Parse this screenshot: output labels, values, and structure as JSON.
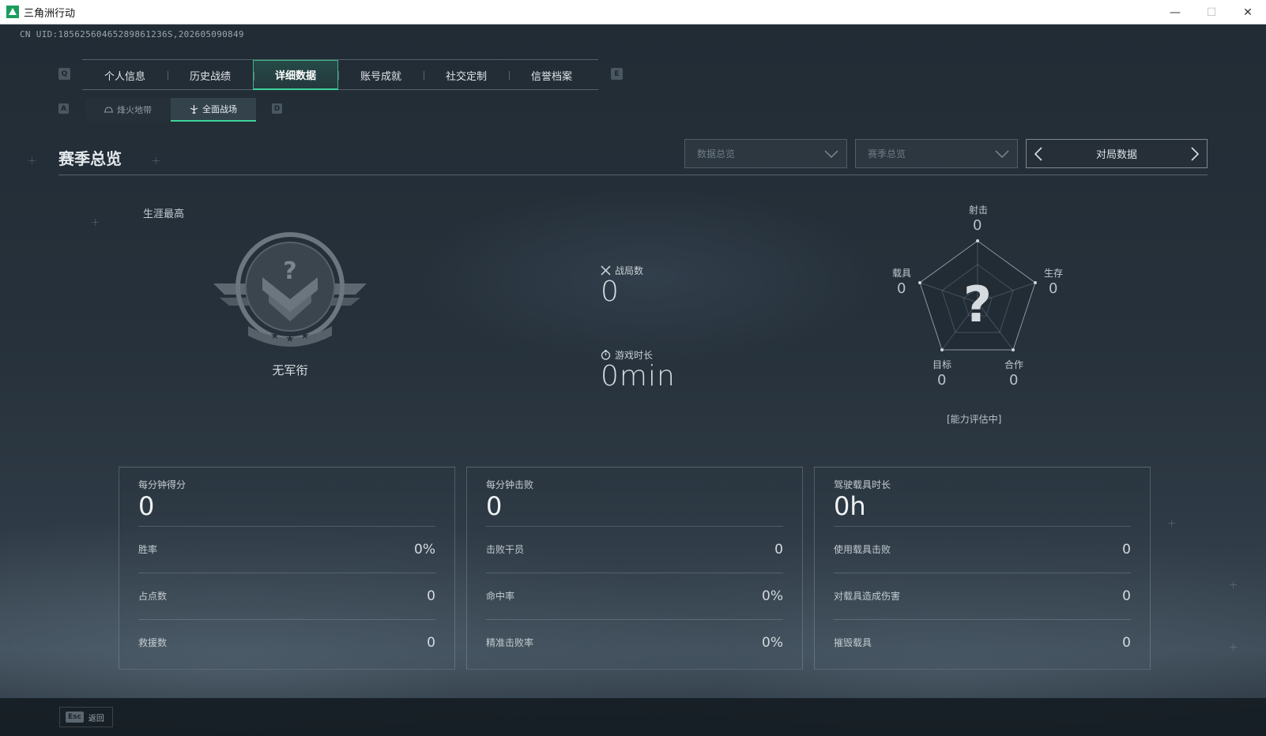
{
  "window": {
    "title": "三角洲行动",
    "minimize": "—",
    "maximize": "☐",
    "close": "✕"
  },
  "uid": "CN UID:18562560465289861236S,202605090849",
  "tabs": {
    "prev_key": "Q",
    "next_key": "E",
    "items": [
      {
        "label": "个人信息",
        "active": false
      },
      {
        "label": "历史战绩",
        "active": false
      },
      {
        "label": "详细数据",
        "active": true
      },
      {
        "label": "账号成就",
        "active": false
      },
      {
        "label": "社交定制",
        "active": false
      },
      {
        "label": "信誉档案",
        "active": false
      }
    ]
  },
  "subtabs": {
    "prev_key": "A",
    "next_key": "D",
    "items": [
      {
        "label": "烽火地带",
        "icon": "helmet-icon",
        "active": false
      },
      {
        "label": "全面战场",
        "icon": "plane-icon",
        "active": true
      }
    ]
  },
  "header": {
    "title": "赛季总览",
    "dropdown_data": "数据总览",
    "dropdown_season": "赛季总览",
    "pager_label": "对局数据"
  },
  "rank": {
    "career_label": "生涯最高",
    "name": "无军衔"
  },
  "center": {
    "matches_label": "战局数",
    "matches_value": "0",
    "playtime_label": "游戏时长",
    "playtime_value": "0min"
  },
  "radar": {
    "axes": [
      {
        "label": "射击",
        "value": "0"
      },
      {
        "label": "生存",
        "value": "0"
      },
      {
        "label": "合作",
        "value": "0"
      },
      {
        "label": "目标",
        "value": "0"
      },
      {
        "label": "载具",
        "value": "0"
      }
    ],
    "center_symbol": "?",
    "status": "[能力评估中]"
  },
  "panels": [
    {
      "title": "每分钟得分",
      "value": "0",
      "rows": [
        {
          "label": "胜率",
          "value": "0%"
        },
        {
          "label": "占点数",
          "value": "0"
        },
        {
          "label": "救援数",
          "value": "0"
        }
      ]
    },
    {
      "title": "每分钟击败",
      "value": "0",
      "rows": [
        {
          "label": "击败干员",
          "value": "0"
        },
        {
          "label": "命中率",
          "value": "0%"
        },
        {
          "label": "精准击败率",
          "value": "0%"
        }
      ]
    },
    {
      "title": "驾驶载具时长",
      "value": "0h",
      "rows": [
        {
          "label": "使用载具击败",
          "value": "0"
        },
        {
          "label": "对载具造成伤害",
          "value": "0"
        },
        {
          "label": "摧毁载具",
          "value": "0"
        }
      ]
    }
  ],
  "footer": {
    "esc_key": "Esc",
    "back_label": "返回"
  },
  "colors": {
    "accent": "#3fd39a",
    "background": "#26313b"
  }
}
